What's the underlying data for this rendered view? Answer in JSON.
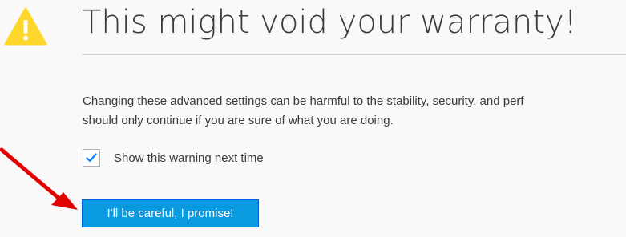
{
  "page": {
    "title": "This might void your warranty!",
    "message_line1": "Changing these advanced settings can be harmful to the stability, security, and perf",
    "message_line2": "should only continue if you are sure of what you are doing.",
    "checkbox_label": "Show this warning next time",
    "checkbox_checked": true,
    "button_label": "I'll be careful, I promise!"
  },
  "icons": {
    "warning": "warning-triangle-icon",
    "check": "checkmark-icon",
    "annotation": "red-arrow-annotation"
  },
  "colors": {
    "warning_icon": "#ffd62c",
    "accent": "#0a9ae0",
    "check": "#0a84ff",
    "annotation_arrow": "#e30000"
  }
}
